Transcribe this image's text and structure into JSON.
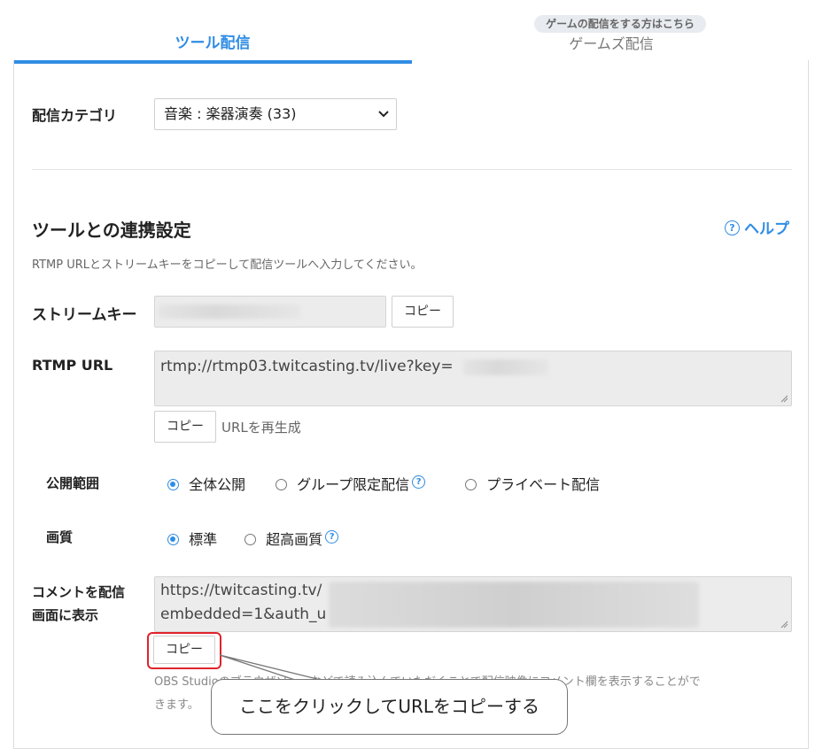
{
  "tabs": {
    "tool": {
      "label": "ツール配信"
    },
    "game": {
      "label": "ゲームズ配信",
      "badge": "ゲームの配信をする方はこちら"
    }
  },
  "category": {
    "label": "配信カテゴリ",
    "selected": "音楽 : 楽器演奏 (33)"
  },
  "integration": {
    "title": "ツールとの連携設定",
    "help_label": "ヘルプ",
    "description": "RTMP URLとストリームキーをコピーして配信ツールへ入力してください。"
  },
  "stream_key": {
    "label": "ストリームキー",
    "copy_label": "コピー"
  },
  "rtmp": {
    "label": "RTMP URL",
    "value": "rtmp://rtmp03.twitcasting.tv/live?key=",
    "copy_label": "コピー",
    "regenerate_label": "URLを再生成"
  },
  "visibility": {
    "label": "公開範囲",
    "options": [
      "全体公開",
      "グループ限定配信",
      "プライベート配信"
    ],
    "selected_index": 0
  },
  "quality": {
    "label": "画質",
    "options": [
      "標準",
      "超高画質"
    ],
    "selected_index": 0
  },
  "comment": {
    "label_line1": "コメントを配信",
    "label_line2": "画面に表示",
    "value_line1": "https://twitcasting.tv/",
    "value_line2": "embedded=1&auth_u",
    "copy_label": "コピー",
    "note_line1": "OBS Studioのブラウザソースなどで読み込んでいただくことで配信映像にコメント欄を表示することがで",
    "note_line2": "きます。"
  },
  "callout": {
    "text": "ここをクリックしてURLをコピーする"
  },
  "colors": {
    "accent": "#2f8de4",
    "highlight_box": "#e0232b"
  }
}
